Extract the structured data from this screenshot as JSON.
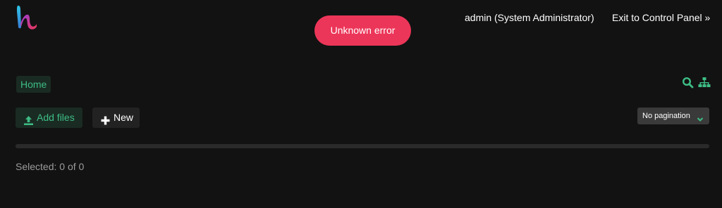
{
  "header": {
    "logo_icon": "brand-logo-icon",
    "user": "admin (System Administrator)",
    "exit_link": "Exit to Control Panel »"
  },
  "toast": {
    "message": "Unknown error",
    "color": "#ec3659"
  },
  "breadcrumb": {
    "items": [
      "Home"
    ]
  },
  "toolbar": {
    "search_icon": "search-icon",
    "sitemap_icon": "sitemap-icon",
    "add_files_label": "Add files",
    "add_files_icon": "upload-icon",
    "new_label": "New",
    "new_icon": "plus-icon"
  },
  "pagination": {
    "selected": "No pagination",
    "icon": "chevron-down-icon"
  },
  "status": {
    "selected_text": "Selected: 0 of 0"
  },
  "colors": {
    "accent": "#3dbd85",
    "background": "#121212"
  }
}
